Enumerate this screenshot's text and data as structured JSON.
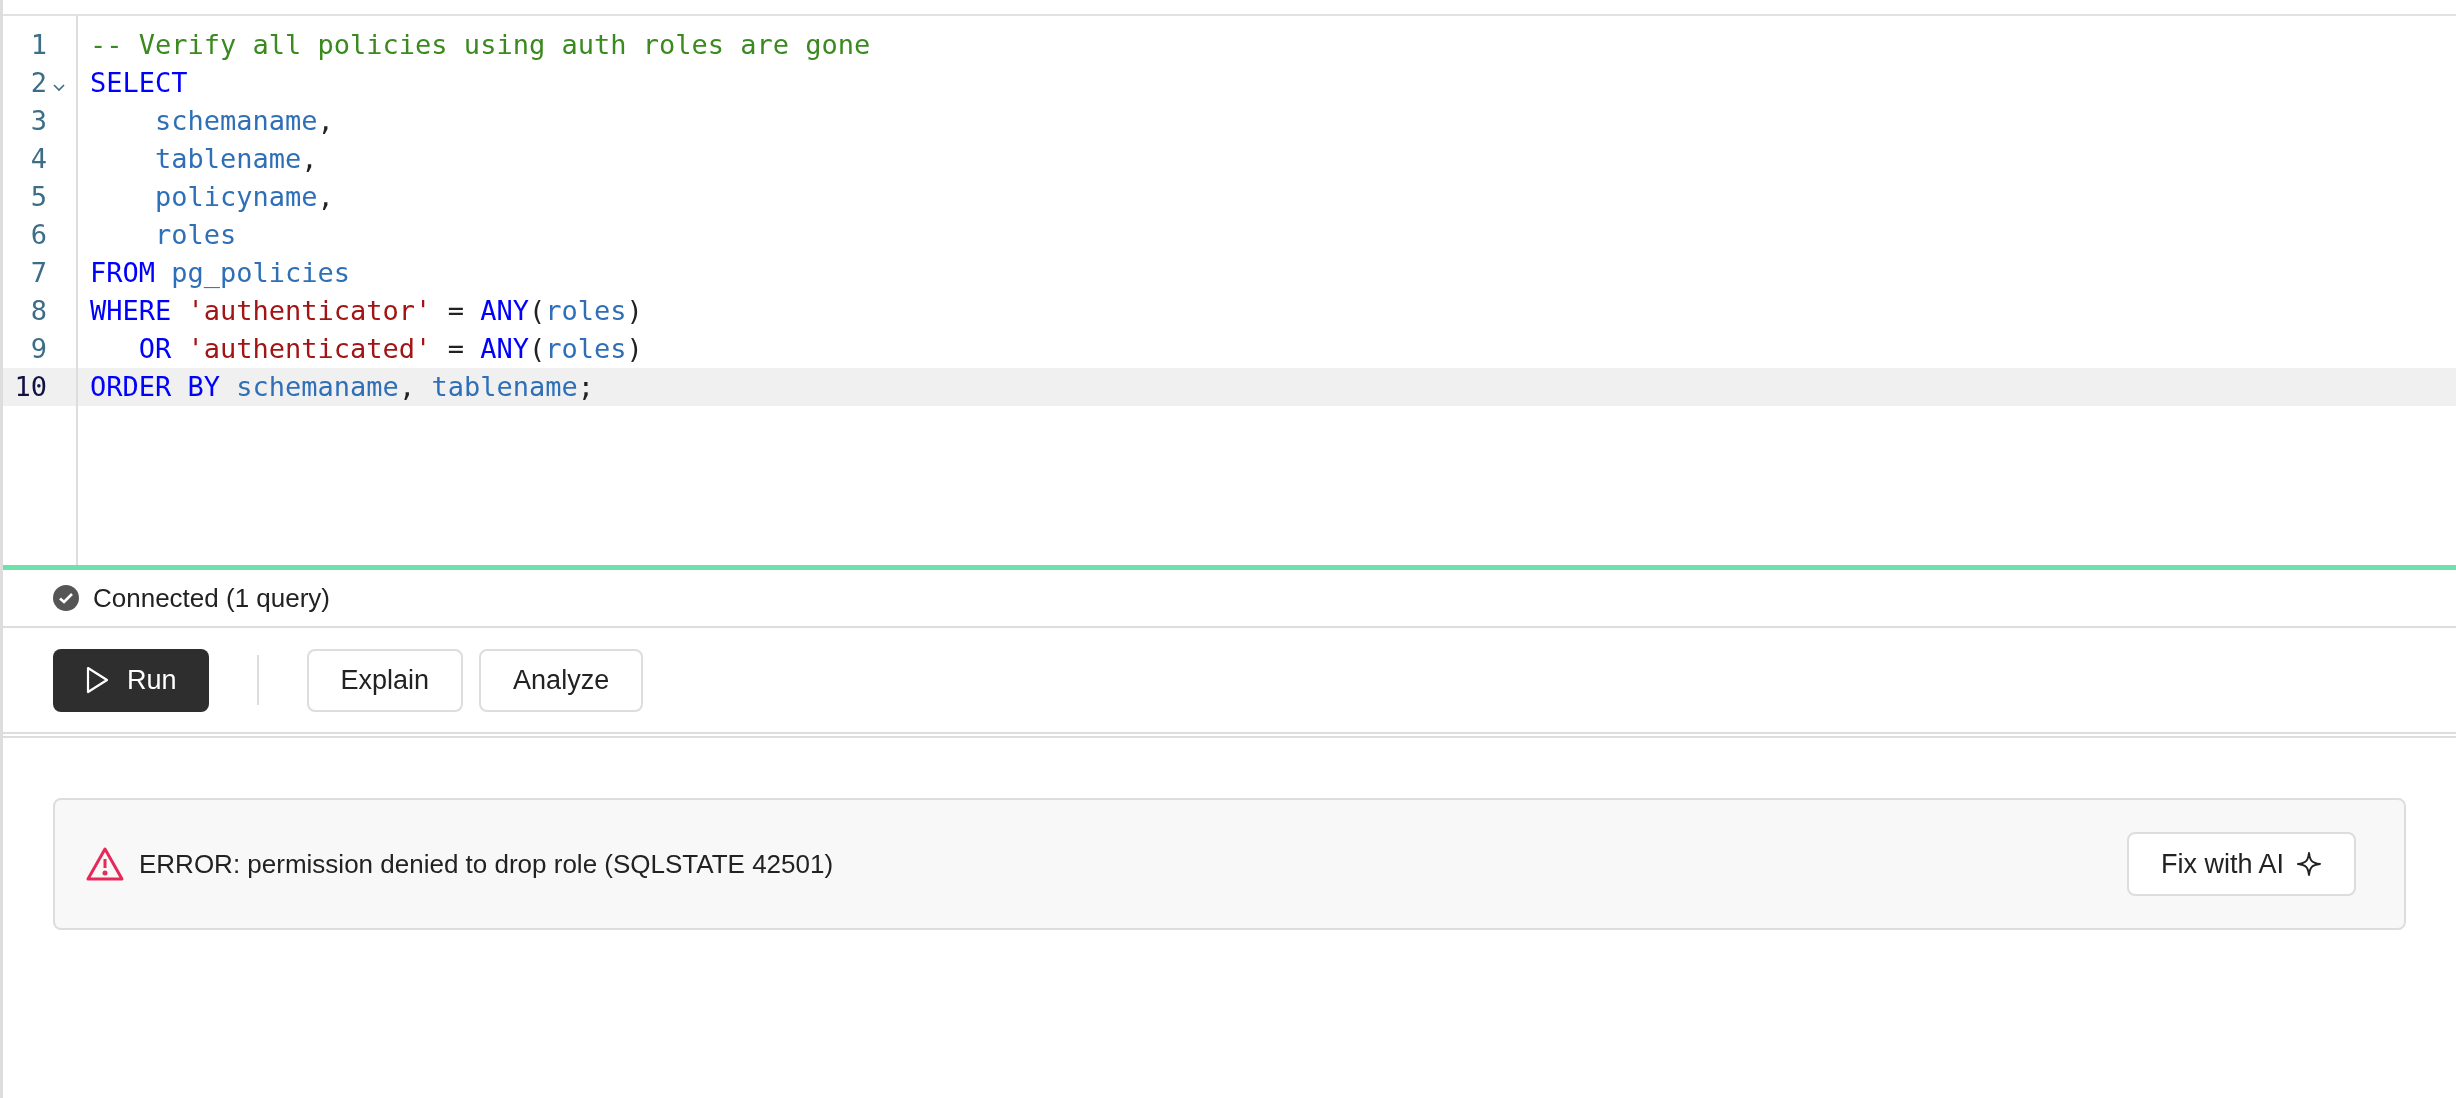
{
  "editor": {
    "lines": [
      {
        "number": "1",
        "active": false,
        "foldable": false,
        "tokens": [
          {
            "kind": "comment",
            "text": "-- Verify all policies using auth roles are gone"
          }
        ]
      },
      {
        "number": "2",
        "active": false,
        "foldable": true,
        "tokens": [
          {
            "kind": "keyword",
            "text": "SELECT"
          }
        ]
      },
      {
        "number": "3",
        "active": false,
        "foldable": false,
        "tokens": [
          {
            "kind": "identifier",
            "text": "    schemaname"
          },
          {
            "kind": "plain",
            "text": ","
          }
        ]
      },
      {
        "number": "4",
        "active": false,
        "foldable": false,
        "tokens": [
          {
            "kind": "identifier",
            "text": "    tablename"
          },
          {
            "kind": "plain",
            "text": ","
          }
        ]
      },
      {
        "number": "5",
        "active": false,
        "foldable": false,
        "tokens": [
          {
            "kind": "identifier",
            "text": "    policyname"
          },
          {
            "kind": "plain",
            "text": ","
          }
        ]
      },
      {
        "number": "6",
        "active": false,
        "foldable": false,
        "tokens": [
          {
            "kind": "identifier",
            "text": "    roles"
          }
        ]
      },
      {
        "number": "7",
        "active": false,
        "foldable": false,
        "tokens": [
          {
            "kind": "keyword",
            "text": "FROM "
          },
          {
            "kind": "identifier",
            "text": "pg_policies"
          }
        ]
      },
      {
        "number": "8",
        "active": false,
        "foldable": false,
        "tokens": [
          {
            "kind": "keyword",
            "text": "WHERE "
          },
          {
            "kind": "string",
            "text": "'authenticator'"
          },
          {
            "kind": "plain",
            "text": " = "
          },
          {
            "kind": "keyword",
            "text": "ANY"
          },
          {
            "kind": "plain",
            "text": "("
          },
          {
            "kind": "identifier",
            "text": "roles"
          },
          {
            "kind": "plain",
            "text": ")"
          }
        ]
      },
      {
        "number": "9",
        "active": false,
        "foldable": false,
        "tokens": [
          {
            "kind": "keyword",
            "text": "   OR "
          },
          {
            "kind": "string",
            "text": "'authenticated'"
          },
          {
            "kind": "plain",
            "text": " = "
          },
          {
            "kind": "keyword",
            "text": "ANY"
          },
          {
            "kind": "plain",
            "text": "("
          },
          {
            "kind": "identifier",
            "text": "roles"
          },
          {
            "kind": "plain",
            "text": ")"
          }
        ]
      },
      {
        "number": "10",
        "active": true,
        "foldable": false,
        "tokens": [
          {
            "kind": "keyword",
            "text": "ORDER BY "
          },
          {
            "kind": "identifier",
            "text": "schemaname"
          },
          {
            "kind": "plain",
            "text": ", "
          },
          {
            "kind": "identifier",
            "text": "tablename"
          },
          {
            "kind": "plain",
            "text": ";"
          }
        ]
      }
    ]
  },
  "status": {
    "text": "Connected (1 query)",
    "connected": true
  },
  "actions": [
    {
      "label": "Run",
      "kind": "primary"
    },
    {
      "label": "Explain",
      "kind": "secondary"
    },
    {
      "label": "Analyze",
      "kind": "secondary"
    }
  ],
  "error": {
    "message": "ERROR: permission denied to drop role (SQLSTATE 42501)",
    "button": "Fix with AI"
  }
}
